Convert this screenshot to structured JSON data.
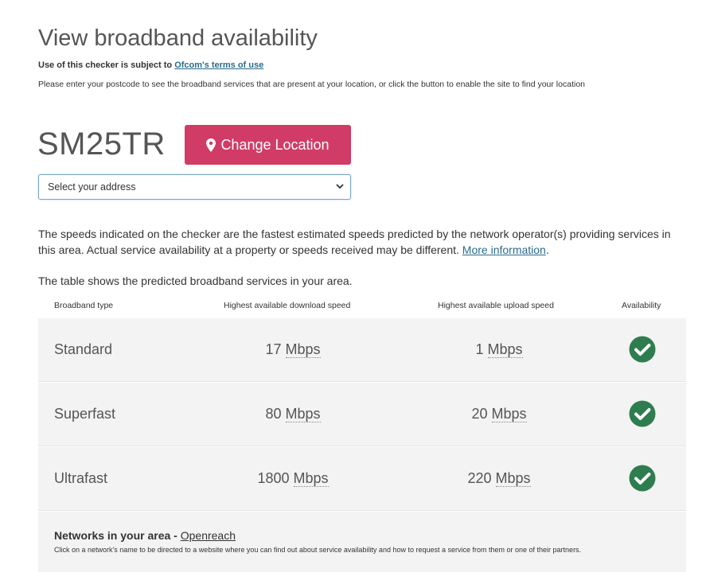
{
  "header": {
    "title": "View broadband availability",
    "terms_prefix": "Use of this checker is subject to",
    "terms_link": "Ofcom's terms of use",
    "intro": "Please enter your postcode to see the broadband services that are present at your location, or click the button to enable the site to find your location"
  },
  "location": {
    "postcode": "SM25TR",
    "change_button": "Change Location",
    "address_select": "Select your address"
  },
  "notes": {
    "speed_note": "The speeds indicated on the checker are the fastest estimated speeds predicted by the network operator(s) providing services in this area. Actual service availability at a property or speeds received may be different.",
    "more_info_link": "More information",
    "table_caption": "The table shows the predicted broadband services in your area."
  },
  "table": {
    "headers": [
      "Broadband type",
      "Highest available download speed",
      "Highest available upload speed",
      "Availability"
    ],
    "unit": "Mbps",
    "rows": [
      {
        "type": "Standard",
        "download": "17",
        "upload": "1",
        "available": true
      },
      {
        "type": "Superfast",
        "download": "80",
        "upload": "20",
        "available": true
      },
      {
        "type": "Ultrafast",
        "download": "1800",
        "upload": "220",
        "available": true
      }
    ]
  },
  "networks": {
    "label": "Networks in your area",
    "separator": " - ",
    "operator": "Openreach",
    "description": "Click on a network's name to be directed to a website where you can find out about service availability and how to request a service from them or one of their partners."
  },
  "colors": {
    "accent": "#d13c67",
    "check": "#2e7d4f",
    "link": "#2a6b8c"
  }
}
